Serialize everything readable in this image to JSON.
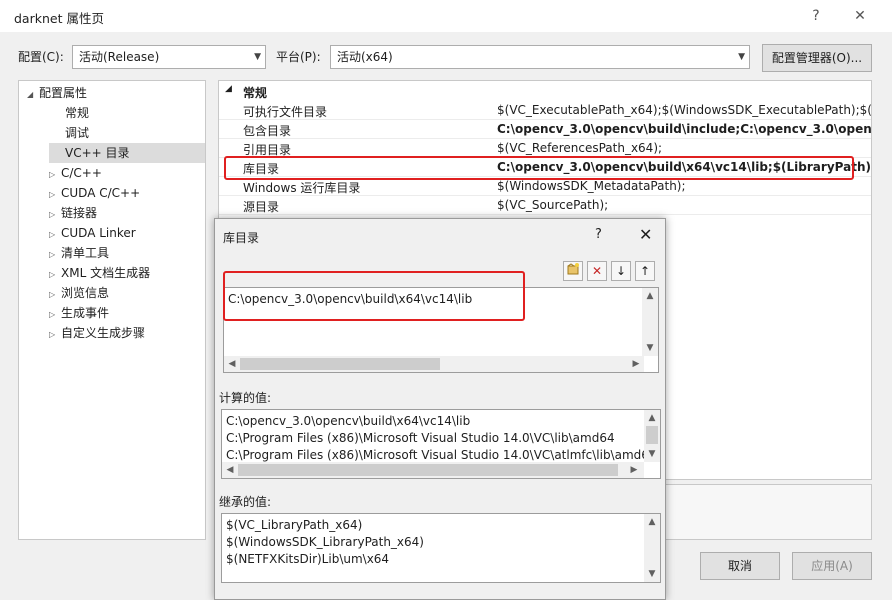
{
  "window": {
    "title": "darknet 属性页",
    "help": "?",
    "close": "✕"
  },
  "toolbar": {
    "config_label": "配置(C):",
    "config_value": "活动(Release)",
    "platform_label": "平台(P):",
    "platform_value": "活动(x64)",
    "config_manager": "配置管理器(O)..."
  },
  "tree": {
    "root": "配置属性",
    "items": [
      "常规",
      "调试",
      "VC++ 目录",
      "C/C++",
      "CUDA C/C++",
      "链接器",
      "CUDA Linker",
      "清单工具",
      "XML 文档生成器",
      "浏览信息",
      "生成事件",
      "自定义生成步骤"
    ]
  },
  "grid": {
    "category": "常规",
    "rows": [
      {
        "name": "可执行文件目录",
        "value": "$(VC_ExecutablePath_x64);$(WindowsSDK_ExecutablePath);$(VS_E"
      },
      {
        "name": "包含目录",
        "value": "C:\\opencv_3.0\\opencv\\build\\include;C:\\opencv_3.0\\opencv\\bu"
      },
      {
        "name": "引用目录",
        "value": "$(VC_ReferencesPath_x64);"
      },
      {
        "name": "库目录",
        "value": "C:\\opencv_3.0\\opencv\\build\\x64\\vc14\\lib;$(LibraryPath)"
      },
      {
        "name": "Windows 运行库目录",
        "value": "$(WindowsSDK_MetadataPath);"
      },
      {
        "name": "源目录",
        "value": "$(VC_SourcePath);"
      }
    ]
  },
  "buttons": {
    "cancel": "取消",
    "apply": "应用(A)"
  },
  "dialog": {
    "title": "库目录",
    "help": "?",
    "close": "✕",
    "edit_line": "C:\\opencv_3.0\\opencv\\build\\x64\\vc14\\lib",
    "computed_label": "计算的值:",
    "computed": [
      "C:\\opencv_3.0\\opencv\\build\\x64\\vc14\\lib",
      "C:\\Program Files (x86)\\Microsoft Visual Studio 14.0\\VC\\lib\\amd64",
      "C:\\Program Files (x86)\\Microsoft Visual Studio 14.0\\VC\\atlmfc\\lib\\amd6"
    ],
    "inherited_label": "继承的值:",
    "inherited": [
      "$(VC_LibraryPath_x64)",
      "$(WindowsSDK_LibraryPath_x64)",
      "$(NETFXKitsDir)Lib\\um\\x64"
    ]
  }
}
